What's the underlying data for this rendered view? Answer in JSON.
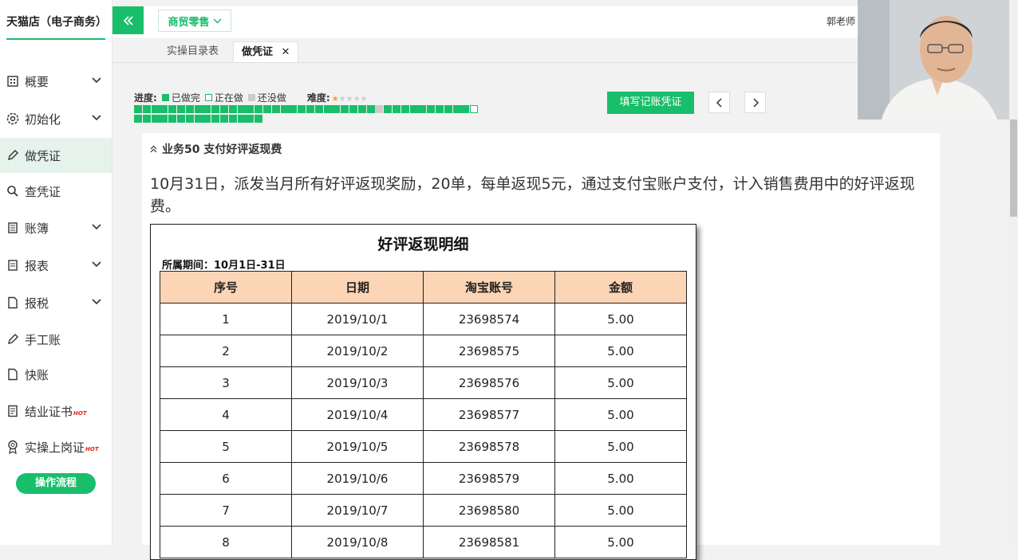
{
  "sidebar": {
    "brand": "天猫店（电子商务）",
    "items": [
      {
        "label": "概要",
        "icon": "grid-icon",
        "chevron": true
      },
      {
        "label": "初始化",
        "icon": "gear-icon",
        "chevron": true
      },
      {
        "label": "做凭证",
        "icon": "pencil-icon",
        "chevron": false,
        "active": true
      },
      {
        "label": "查凭证",
        "icon": "search-icon",
        "chevron": false
      },
      {
        "label": "账簿",
        "icon": "book-icon",
        "chevron": true
      },
      {
        "label": "报表",
        "icon": "report-icon",
        "chevron": true
      },
      {
        "label": "报税",
        "icon": "document-icon",
        "chevron": true
      },
      {
        "label": "手工账",
        "icon": "pencil-icon",
        "chevron": false
      },
      {
        "label": "快账",
        "icon": "document-icon",
        "chevron": false
      },
      {
        "label": "结业证书",
        "icon": "certificate-icon",
        "chevron": false,
        "hot": "HOT"
      },
      {
        "label": "实操上岗证",
        "icon": "badge-icon",
        "chevron": false,
        "hot": "HOT"
      }
    ],
    "flow_button": "操作流程"
  },
  "topbar": {
    "module": "商贸零售",
    "user": "郭老师"
  },
  "tabs": [
    "实操目录表",
    "做凭证"
  ],
  "progress": {
    "label": "进度:",
    "done_label": "已做完",
    "doing_label": "正在做",
    "todo_label": "还没做",
    "difficulty_label": "难度:",
    "difficulty": 1,
    "difficulty_max": 5,
    "colors": {
      "done": "#19be6b",
      "doing": "#ffffff",
      "todo": "#cccccc"
    }
  },
  "actions": {
    "fill_voucher": "填写记账凭证"
  },
  "task": {
    "title": "业务50 支付好评返现费",
    "description": "10月31日，派发当月所有好评返现奖励，20单，每单返现5元，通过支付宝账户支付，计入销售费用中的好评返现费。"
  },
  "document": {
    "title": "好评返现明细",
    "period": "所属期间：10月1日-31日",
    "headers": [
      "序号",
      "日期",
      "淘宝账号",
      "金额"
    ],
    "rows": [
      [
        "1",
        "2019/10/1",
        "23698574",
        "5.00"
      ],
      [
        "2",
        "2019/10/2",
        "23698575",
        "5.00"
      ],
      [
        "3",
        "2019/10/3",
        "23698576",
        "5.00"
      ],
      [
        "4",
        "2019/10/4",
        "23698577",
        "5.00"
      ],
      [
        "5",
        "2019/10/5",
        "23698578",
        "5.00"
      ],
      [
        "6",
        "2019/10/6",
        "23698579",
        "5.00"
      ],
      [
        "7",
        "2019/10/7",
        "23698580",
        "5.00"
      ],
      [
        "8",
        "2019/10/8",
        "23698581",
        "5.00"
      ]
    ]
  }
}
